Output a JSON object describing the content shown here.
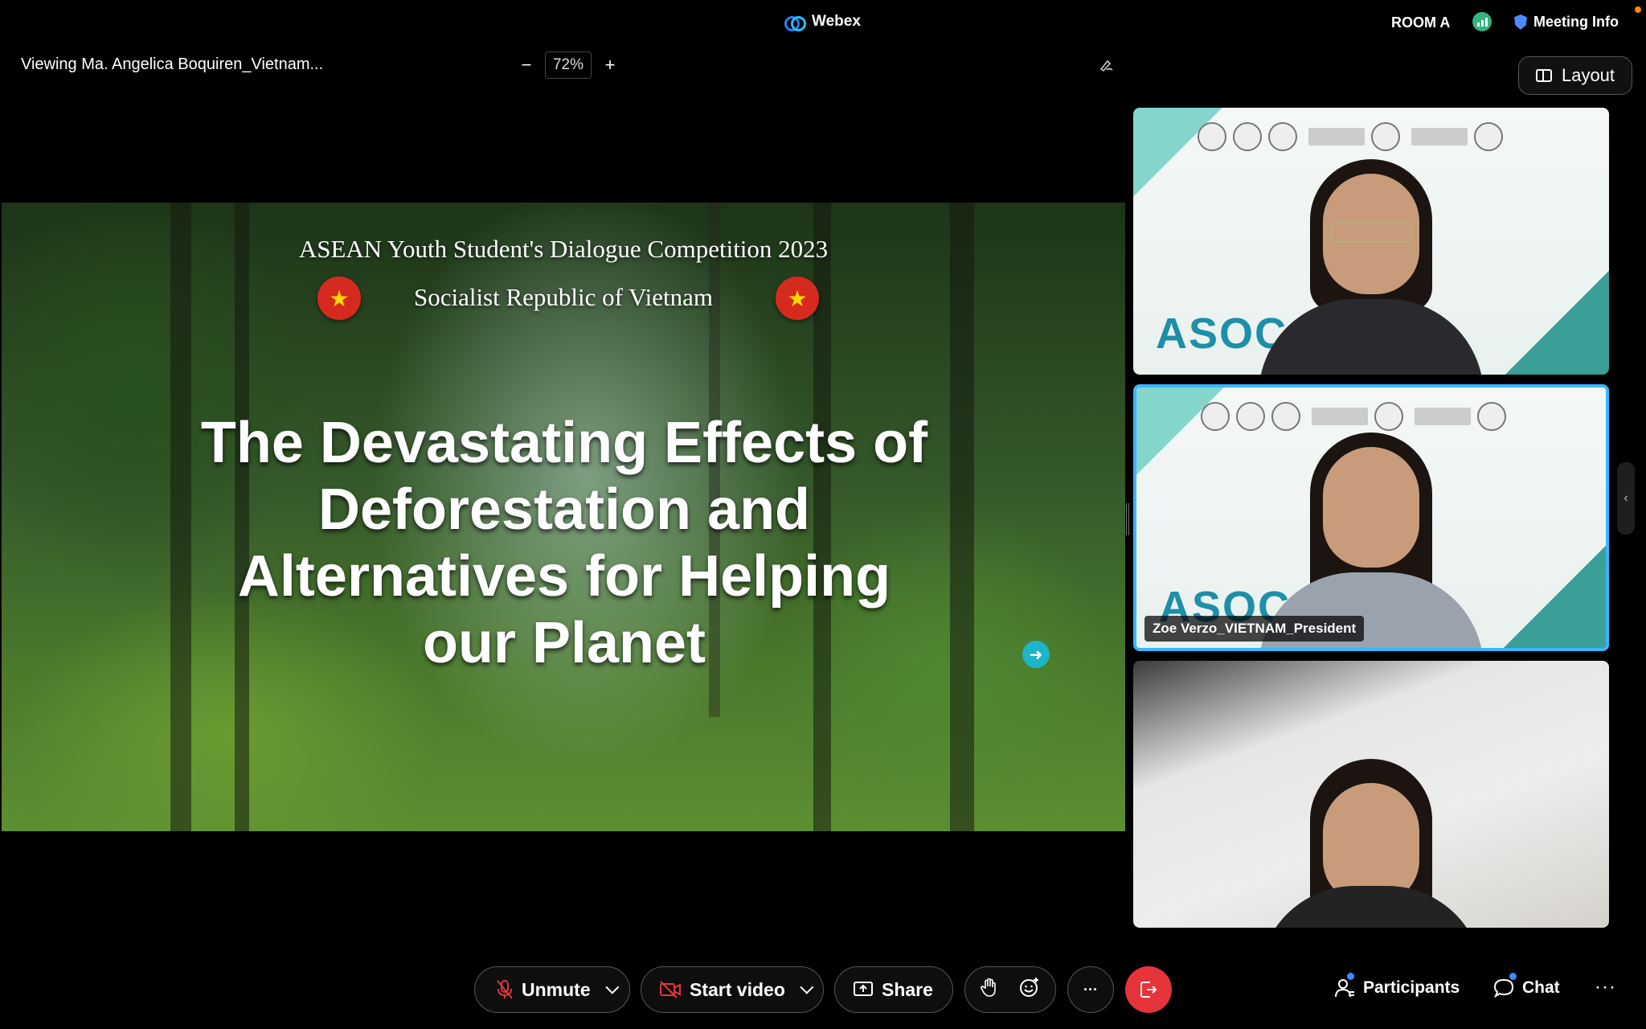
{
  "titlebar": {
    "app_name": "Webex",
    "room": "ROOM A",
    "meeting_info": "Meeting Info"
  },
  "toolbar": {
    "viewing": "Viewing Ma. Angelica Boquiren_Vietnam...",
    "zoom_minus": "−",
    "zoom_value": "72%",
    "zoom_plus": "+",
    "layout_label": "Layout"
  },
  "slide": {
    "subtitle": "ASEAN Youth Student's Dialogue Competition 2023",
    "country": "Socialist Republic of Vietnam",
    "flag_star": "★",
    "title_lines": [
      "The Devastating Effects of",
      "Deforestation and",
      "Alternatives for Helping",
      "our Planet"
    ]
  },
  "participants": [
    {
      "name": "",
      "active": false
    },
    {
      "name": "Zoe Verzo_VIETNAM_President",
      "active": true
    },
    {
      "name": "",
      "active": false
    }
  ],
  "conference_mark": "ASOC",
  "controls": {
    "unmute": "Unmute",
    "start_video": "Start video",
    "share": "Share",
    "more": "···",
    "participants": "Participants",
    "chat": "Chat",
    "more_right": "···"
  },
  "colors": {
    "end_call": "#e5343a",
    "active_border": "#38b6ff",
    "accent_blue": "#3a8cff"
  }
}
